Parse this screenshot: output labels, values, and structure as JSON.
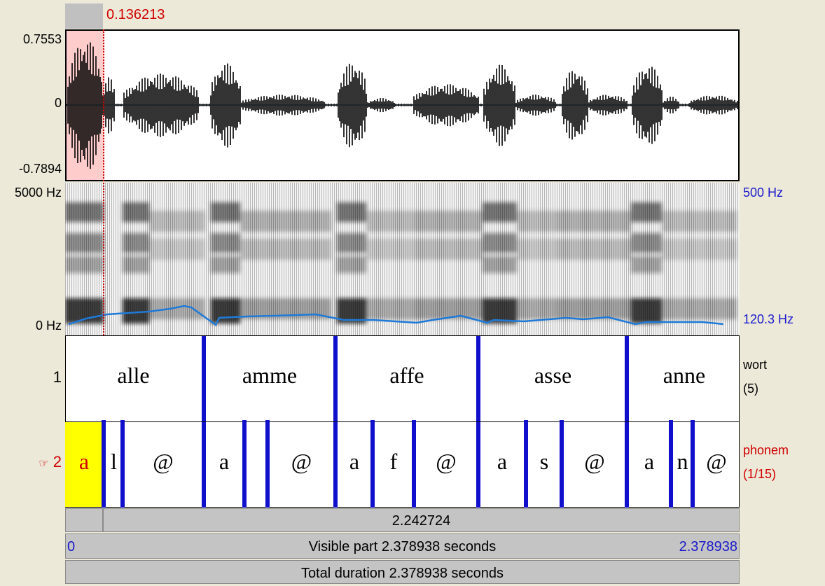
{
  "cursor_time": "0.136213",
  "waveform": {
    "max": "0.7553",
    "zero": "0",
    "min": "-0.7894"
  },
  "spectrogram": {
    "left_top": "5000 Hz",
    "left_bottom": "0 Hz",
    "right_top": "500 Hz",
    "right_bottom": "120.3 Hz"
  },
  "tier1": {
    "number": "1",
    "name": "wort",
    "count": "(5)",
    "intervals": [
      "alle",
      "amme",
      "affe",
      "asse",
      "anne"
    ]
  },
  "tier2": {
    "pointer": "☞",
    "number": "2",
    "name": "phonem",
    "count": "(1/15)",
    "intervals": [
      "a",
      "l",
      "@",
      "a",
      "@",
      "a",
      "f",
      "@",
      "a",
      "s",
      "@",
      "a",
      "n",
      "@"
    ]
  },
  "selection_duration": "2.242724",
  "visible_start": "0",
  "visible_part": "Visible part 2.378938 seconds",
  "visible_end": "2.378938",
  "total_duration": "Total duration 2.378938 seconds",
  "colors": {
    "boundary": "#1010cc",
    "pitch": "#1e7ad8",
    "selection": "#ffcccc",
    "selected_interval": "#ffff00",
    "cursor": "#d00000"
  }
}
